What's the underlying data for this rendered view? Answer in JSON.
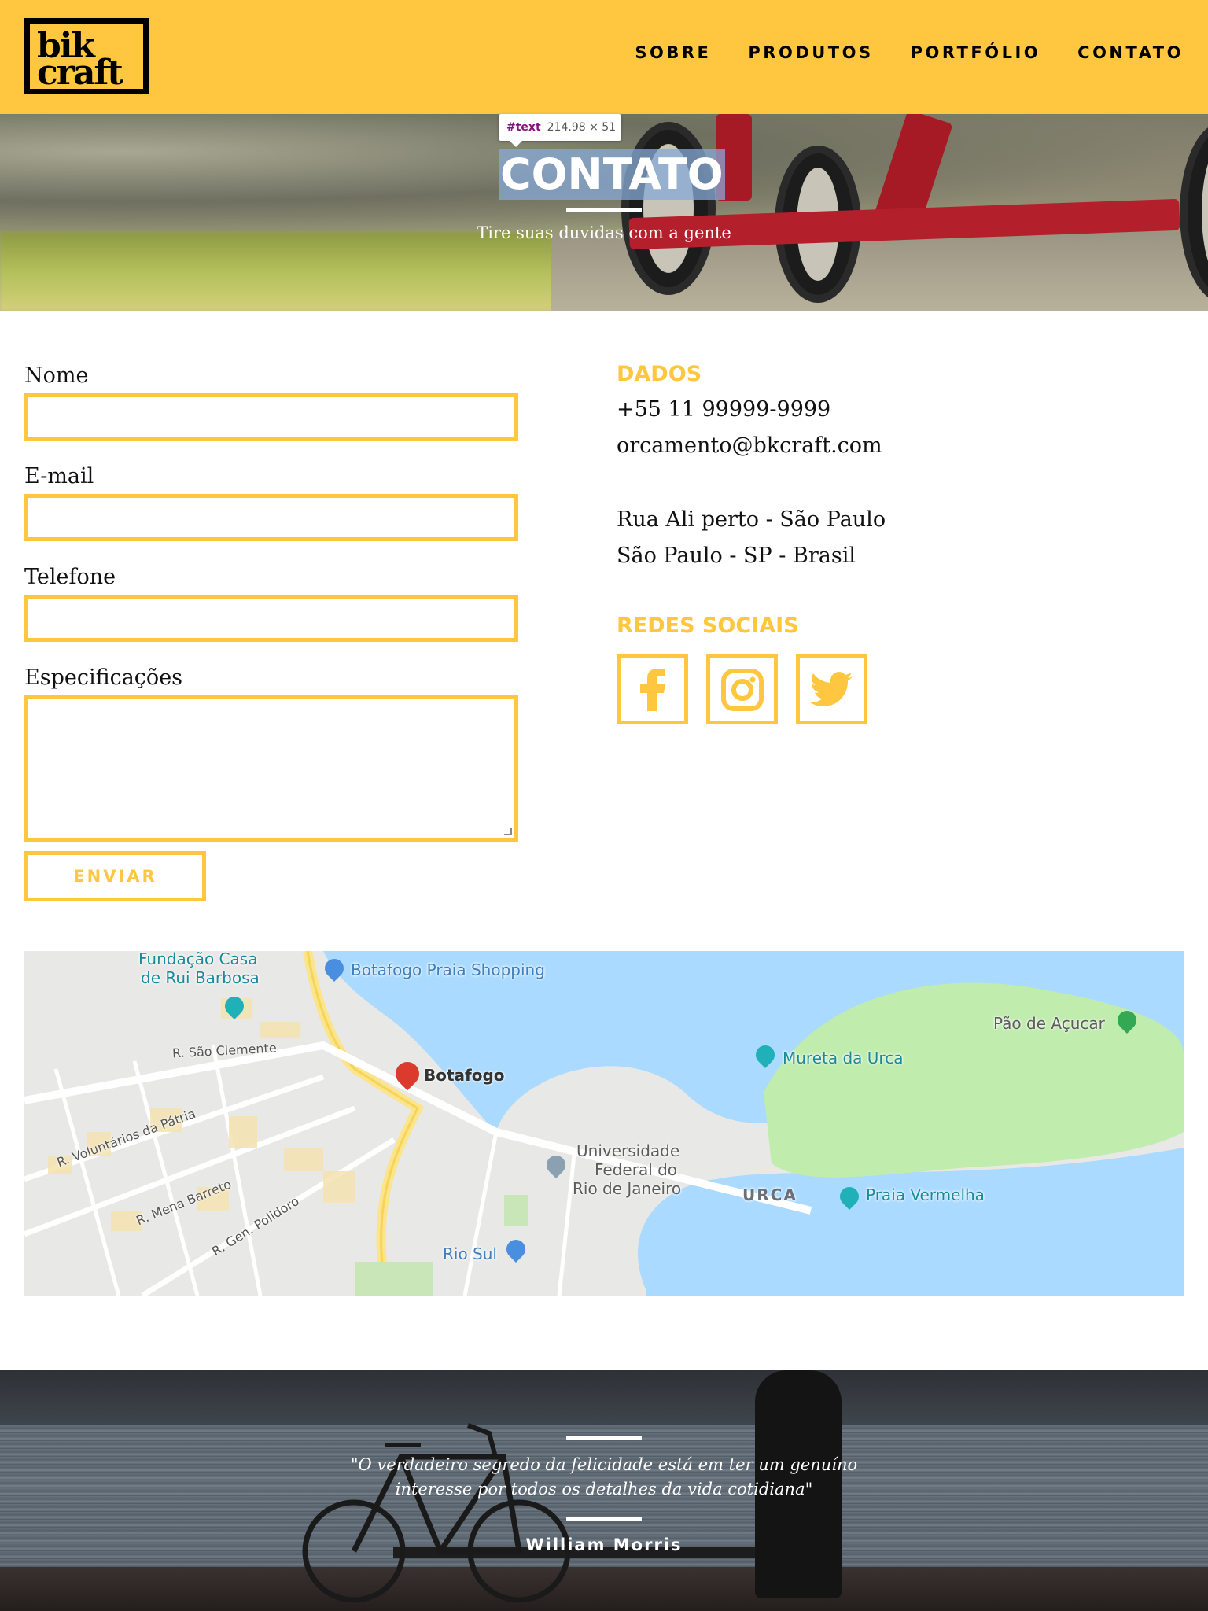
{
  "brand": {
    "logo_line1": "bik",
    "logo_line2": "craft"
  },
  "nav": {
    "items": [
      {
        "label": "SOBRE"
      },
      {
        "label": "PRODUTOS"
      },
      {
        "label": "PORTFÓLIO"
      },
      {
        "label": "CONTATO"
      }
    ]
  },
  "colors": {
    "accent": "#FFC740",
    "text": "#111111"
  },
  "devtools_tooltip": {
    "tag": "#text",
    "size": "214.98 × 51"
  },
  "hero": {
    "title": "CONTATO",
    "subtitle": "Tire suas duvidas com a gente"
  },
  "form": {
    "name_label": "Nome",
    "email_label": "E-mail",
    "phone_label": "Telefone",
    "specs_label": "Especificações",
    "submit_label": "ENVIAR"
  },
  "contact": {
    "data_heading": "DADOS",
    "phone": "+55 11 99999-9999",
    "email": "orcamento@bkcraft.com",
    "address_line1": "Rua Ali perto - São Paulo",
    "address_line2": "São Paulo - SP - Brasil",
    "social_heading": "REDES SOCIAIS",
    "social_icons": [
      "facebook-icon",
      "instagram-icon",
      "twitter-icon"
    ]
  },
  "map": {
    "labels": {
      "fundacao_1": "Fundação Casa",
      "fundacao_2": "de Rui Barbosa",
      "botafogo_shopping": "Botafogo Praia Shopping",
      "sao_clemente": "R. São Clemente",
      "botafogo": "Botafogo",
      "mureta": "Mureta da Urca",
      "pao": "Pão de Açucar",
      "univ_1": "Universidade",
      "univ_2": "Federal do",
      "univ_3": "Rio de Janeiro",
      "urca": "URCA",
      "praia_vermelha": "Praia Vermelha",
      "voluntarios": "R. Voluntários da Pátria",
      "mena_barreto": "R. Mena Barreto",
      "gen_polidoro": "R. Gen. Polidoro",
      "rio_sul": "Rio Sul"
    }
  },
  "quote": {
    "text_line1": "\"O verdadeiro segredo da felicidade está em ter um genuíno",
    "text_line2": "interesse por todos os detalhes da vida cotidiana\"",
    "author": "William Morris"
  }
}
